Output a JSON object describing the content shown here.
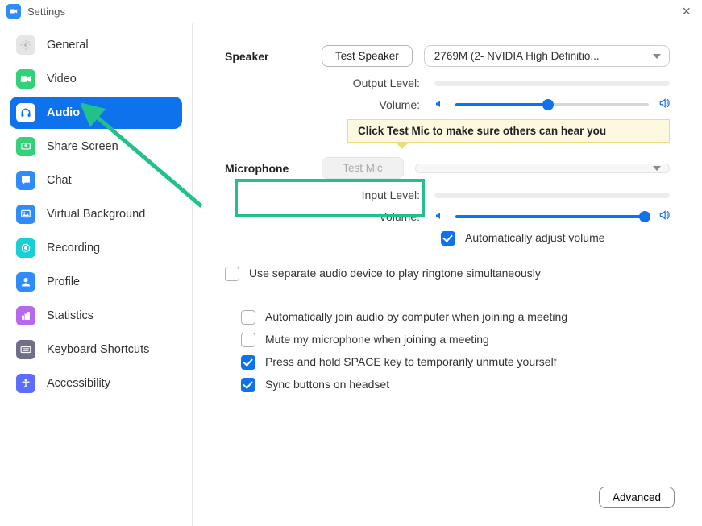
{
  "window": {
    "title": "Settings"
  },
  "sidebar": {
    "items": [
      {
        "label": "General",
        "icon": "gear-icon",
        "color": "#e6e6e6",
        "fg": "#bfbfbf"
      },
      {
        "label": "Video",
        "icon": "video-icon",
        "color": "#33d17a",
        "fg": "#ffffff"
      },
      {
        "label": "Audio",
        "icon": "headphones-icon",
        "color": "#ffffff",
        "fg": "#0e72ed",
        "active": true
      },
      {
        "label": "Share Screen",
        "icon": "share-icon",
        "color": "#33d17a",
        "fg": "#ffffff"
      },
      {
        "label": "Chat",
        "icon": "chat-icon",
        "color": "#2e8cff",
        "fg": "#ffffff"
      },
      {
        "label": "Virtual Background",
        "icon": "image-icon",
        "color": "#2e8cff",
        "fg": "#ffffff"
      },
      {
        "label": "Recording",
        "icon": "record-icon",
        "color": "#17cfd6",
        "fg": "#ffffff"
      },
      {
        "label": "Profile",
        "icon": "person-icon",
        "color": "#2e8cff",
        "fg": "#ffffff"
      },
      {
        "label": "Statistics",
        "icon": "stats-icon",
        "color": "#b867f0",
        "fg": "#ffffff"
      },
      {
        "label": "Keyboard Shortcuts",
        "icon": "keyboard-icon",
        "color": "#6f6f8a",
        "fg": "#ffffff"
      },
      {
        "label": "Accessibility",
        "icon": "accessibility-icon",
        "color": "#5b6cff",
        "fg": "#ffffff"
      }
    ]
  },
  "speaker": {
    "section_label": "Speaker",
    "test_button": "Test Speaker",
    "device": "2769M (2- NVIDIA High Definitio...",
    "output_level_label": "Output Level:",
    "volume_label": "Volume:",
    "volume_percent": 48
  },
  "tooltip": "Click Test Mic to make sure others can hear you",
  "microphone": {
    "section_label": "Microphone",
    "test_button": "Test Mic",
    "device": "",
    "input_level_label": "Input Level:",
    "volume_label": "Volume:",
    "volume_percent": 98,
    "auto_adjust_label": "Automatically adjust volume",
    "auto_adjust_checked": true
  },
  "options": [
    {
      "label": "Use separate audio device to play ringtone simultaneously",
      "checked": false
    },
    {
      "label": "Automatically join audio by computer when joining a meeting",
      "checked": false
    },
    {
      "label": "Mute my microphone when joining a meeting",
      "checked": false
    },
    {
      "label": "Press and hold SPACE key to temporarily unmute yourself",
      "checked": true
    },
    {
      "label": "Sync buttons on headset",
      "checked": true
    }
  ],
  "advanced_button": "Advanced"
}
